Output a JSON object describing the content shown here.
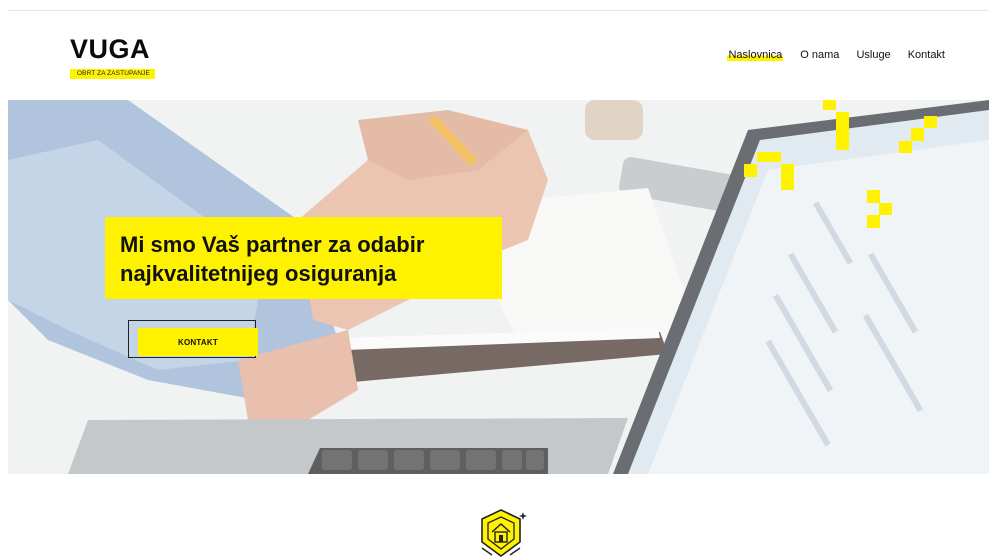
{
  "header": {
    "logo_text": "VUGA",
    "logo_tagline": "OBRT ZA ZASTUPANJE"
  },
  "nav": {
    "items": [
      {
        "label": "Naslovnica",
        "active": true
      },
      {
        "label": "O nama",
        "active": false
      },
      {
        "label": "Usluge",
        "active": false
      },
      {
        "label": "Kontakt",
        "active": false
      }
    ]
  },
  "hero": {
    "headline_line1": "Mi smo Vaš partner za odabir",
    "headline_line2": "najkvalitetnijeg osiguranja",
    "cta_label": "KONTAKT"
  },
  "colors": {
    "accent": "#fff200",
    "text": "#111111",
    "background": "#ffffff"
  },
  "icons": {
    "section_icon": "insurance-house-icon"
  }
}
